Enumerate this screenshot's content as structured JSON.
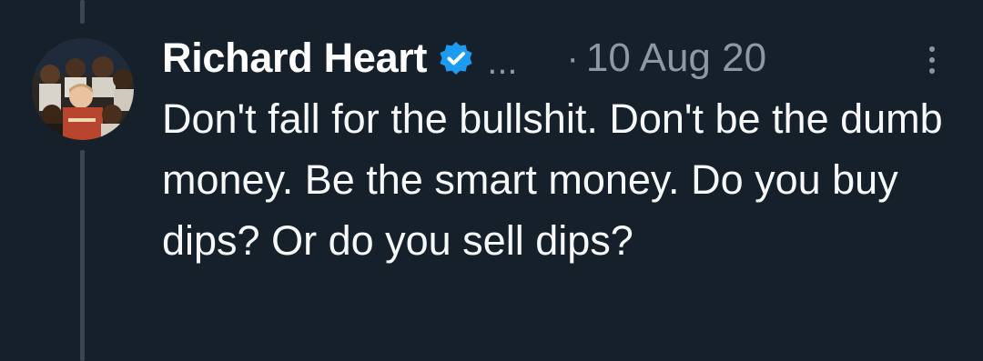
{
  "tweet": {
    "author": {
      "display_name": "Richard Heart",
      "verified_badge": "verified-check-icon"
    },
    "handle_overflow": "...",
    "separator": "·",
    "timestamp": "10 Aug 20",
    "text": "Don't fall for the bullshit. Don't be the dumb money. Be the smart money. Do you buy dips? Or do you sell dips?"
  },
  "colors": {
    "background": "#15202b",
    "primary_text": "#ffffff",
    "secondary_text": "#8b98a5",
    "verified_blue": "#1d9bf0",
    "thread_line": "#3a4651"
  }
}
